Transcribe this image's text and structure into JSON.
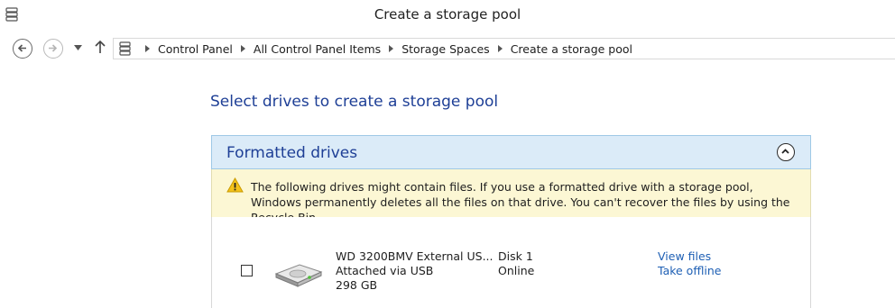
{
  "window": {
    "title": "Create a storage pool",
    "icon": "storage-spaces-icon"
  },
  "nav": {
    "back_icon": "back-arrow-icon",
    "forward_icon": "forward-arrow-icon",
    "recent_icon": "chevron-down-icon",
    "up_icon": "up-arrow-icon"
  },
  "breadcrumb": {
    "icon": "storage-spaces-icon",
    "items": [
      "Control Panel",
      "All Control Panel Items",
      "Storage Spaces",
      "Create a storage pool"
    ]
  },
  "main": {
    "heading": "Select drives to create a storage pool",
    "section": {
      "title": "Formatted drives",
      "collapse_icon": "chevron-up-icon"
    },
    "warning": {
      "icon": "warning-icon",
      "text": "The following drives might contain files. If you use a formatted drive with a storage pool, Windows permanently deletes all the files on that drive. You can't recover the files by using the Recycle Bin."
    },
    "drives": [
      {
        "checked": false,
        "icon": "hard-drive-icon",
        "name": "WD 3200BMV External US...",
        "connection": "Attached via USB",
        "size": "298 GB",
        "disk": "Disk 1",
        "status": "Online",
        "action_view": "View files",
        "action_offline": "Take offline"
      }
    ]
  },
  "colors": {
    "heading_blue": "#1e3f96",
    "link_blue": "#1e5fb4",
    "section_bg": "#dbebf8",
    "warning_bg": "#fcf7d4"
  }
}
